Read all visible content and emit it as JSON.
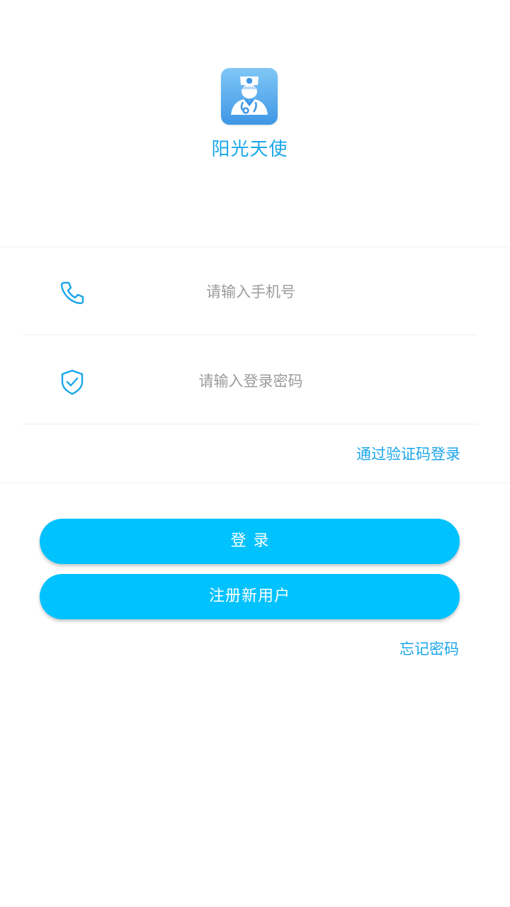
{
  "app": {
    "name": "阳光天使",
    "logo_icon": "doctor-avatar-icon"
  },
  "colors": {
    "accent": "#00c2ff",
    "link": "#1aa6ea",
    "divider": "#efefef",
    "placeholder": "#9b9b9b"
  },
  "form": {
    "phone": {
      "icon": "phone-icon",
      "value": "",
      "placeholder": "请输入手机号"
    },
    "password": {
      "icon": "shield-check-icon",
      "value": "",
      "placeholder": "请输入登录密码"
    },
    "sms_login_link": "通过验证码登录"
  },
  "actions": {
    "login_label": "登录",
    "register_label": "注册新用户",
    "forgot_password_link": "忘记密码"
  }
}
